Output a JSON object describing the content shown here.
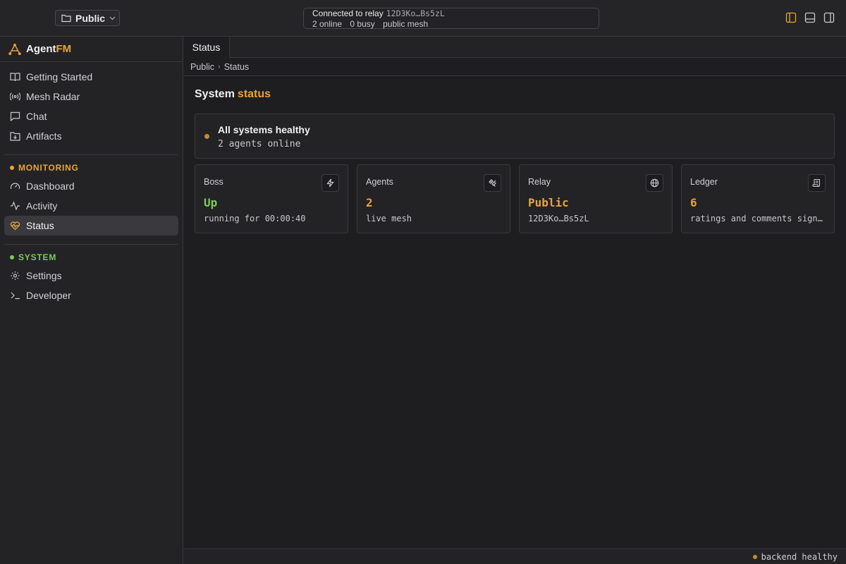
{
  "topbar": {
    "workspace": "Public",
    "relay": {
      "label": "Connected to relay",
      "id": "12D3Ko…Bs5zL",
      "online": "2 online",
      "busy": "0 busy",
      "mesh": "public mesh"
    },
    "layout_icons": [
      "left-panel-icon",
      "bottom-panel-icon",
      "right-panel-icon"
    ]
  },
  "sidebar": {
    "brand": {
      "name": "Agent",
      "accent": "FM"
    },
    "items": [
      {
        "label": "Getting Started",
        "icon": "book-open-icon"
      },
      {
        "label": "Mesh Radar",
        "icon": "radar-icon"
      },
      {
        "label": "Chat",
        "icon": "chat-bubble-icon"
      },
      {
        "label": "Artifacts",
        "icon": "folder-download-icon"
      }
    ],
    "monitoring": {
      "label": "MONITORING",
      "color": "#e8a43a",
      "items": [
        {
          "label": "Dashboard",
          "icon": "gauge-icon"
        },
        {
          "label": "Activity",
          "icon": "activity-icon"
        },
        {
          "label": "Status",
          "icon": "heart-pulse-icon",
          "active": true
        }
      ]
    },
    "system": {
      "label": "SYSTEM",
      "color": "#7dc95e",
      "items": [
        {
          "label": "Settings",
          "icon": "gear-icon"
        },
        {
          "label": "Developer",
          "icon": "terminal-icon"
        }
      ]
    }
  },
  "main": {
    "tab": "Status",
    "breadcrumb": [
      "Public",
      "Status"
    ],
    "title": {
      "prefix": "System",
      "accent": "status"
    },
    "health": {
      "title": "All systems healthy",
      "subtitle": "2 agents online"
    },
    "cards": [
      {
        "label": "Boss",
        "value": "Up",
        "sub": "running for 00:00:40",
        "icon": "lightning-icon",
        "color": "#7dc95e"
      },
      {
        "label": "Agents",
        "value": "2",
        "sub": "live mesh",
        "icon": "satellite-icon",
        "color": "#e8a43a"
      },
      {
        "label": "Relay",
        "value": "Public",
        "sub": "12D3Ko…Bs5zL",
        "icon": "globe-icon",
        "color": "#e8a43a"
      },
      {
        "label": "Ledger",
        "value": "6",
        "sub": "ratings and comments signed",
        "icon": "scroll-icon",
        "color": "#e8a43a"
      }
    ]
  },
  "statusbar": {
    "text": "backend healthy"
  },
  "colors": {
    "accent": "#e8a43a",
    "success": "#7dc95e",
    "dot": "#c08a36"
  }
}
